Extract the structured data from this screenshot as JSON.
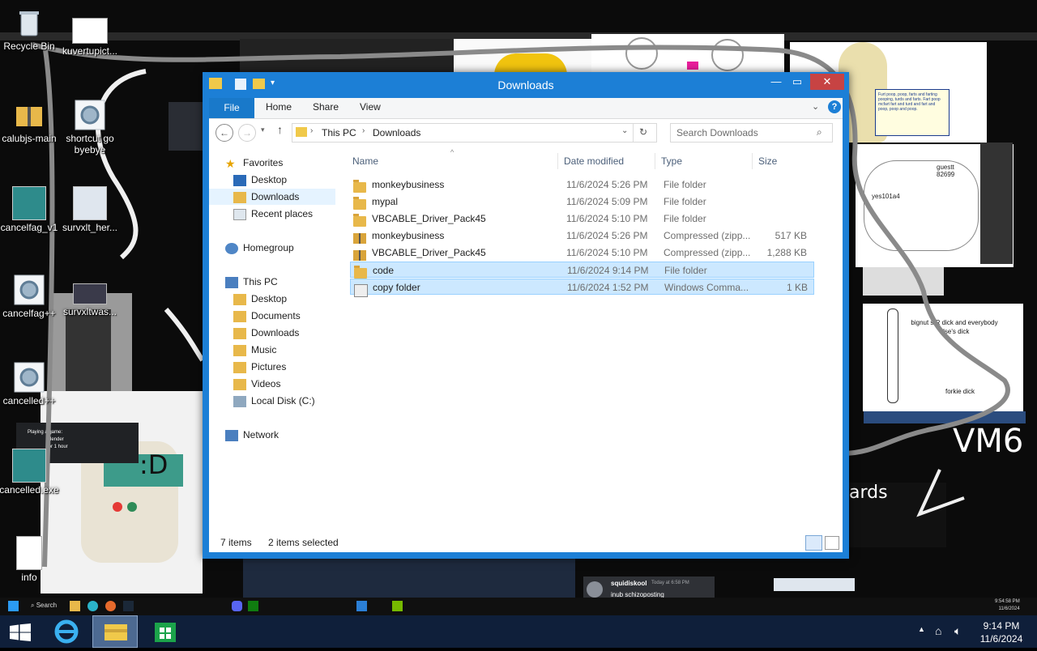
{
  "desktop": {
    "icons": [
      {
        "label": "Recycle Bin",
        "icon": "recycle-bin-icon"
      },
      {
        "label": "kuvertupict...",
        "icon": "image-icon"
      },
      {
        "label": "calubjs-main",
        "icon": "zip-folder-icon"
      },
      {
        "label": "shortcut go byebye",
        "icon": "shortcut-gear-icon"
      },
      {
        "label": "cancelfag_v1",
        "icon": "image-icon"
      },
      {
        "label": "survxlt_her...",
        "icon": "image-icon"
      },
      {
        "label": "cancelfag++",
        "icon": "shortcut-gear-icon"
      },
      {
        "label": "survxltwas...",
        "icon": "image-icon"
      },
      {
        "label": "cancelled++",
        "icon": "shortcut-gear-icon"
      },
      {
        "label": "cancelled.exe",
        "icon": "image-icon"
      },
      {
        "label": "info",
        "icon": "text-file-icon"
      }
    ],
    "overlay_texts": {
      "vm_tag": "VM6",
      "wall_note": "Furt poop, poop, farts and farting pooping, turds and farts. Fart poop mcfart fart and turd and fart and poop, poop and poop.",
      "doodle1": "bignut s/R dick and everybody else's dick",
      "doodle2": "forkie dick",
      "doodle3": "yes101a4",
      "doodle4": "guestt 82699",
      "game_label": "Playing a game:",
      "game_name": "Blender",
      "game_time": "for 1 hour",
      "face": ":D",
      "chat_user": "squidiskool",
      "chat_time": "Today at 6:58 PM",
      "chat_msg": "inub schizoposting",
      "cards": "ards",
      "vm_clock_time": "9:54:58 PM",
      "vm_clock_date": "11/6/2024",
      "vm_search": "Search"
    }
  },
  "explorer": {
    "title": "Downloads",
    "ribbon_tabs": [
      "File",
      "Home",
      "Share",
      "View"
    ],
    "breadcrumb": [
      "This PC",
      "Downloads"
    ],
    "search_placeholder": "Search Downloads",
    "nav": {
      "favorites_label": "Favorites",
      "favorites": [
        "Desktop",
        "Downloads",
        "Recent places"
      ],
      "homegroup": "Homegroup",
      "thispc_label": "This PC",
      "thispc": [
        "Desktop",
        "Documents",
        "Downloads",
        "Music",
        "Pictures",
        "Videos",
        "Local Disk (C:)"
      ],
      "network": "Network"
    },
    "columns": {
      "name": "Name",
      "date": "Date modified",
      "type": "Type",
      "size": "Size"
    },
    "files": [
      {
        "name": "monkeybusiness",
        "date": "11/6/2024 5:26 PM",
        "type": "File folder",
        "size": "",
        "icon": "folder-icon",
        "selected": false
      },
      {
        "name": "mypal",
        "date": "11/6/2024 5:09 PM",
        "type": "File folder",
        "size": "",
        "icon": "folder-icon",
        "selected": false
      },
      {
        "name": "VBCABLE_Driver_Pack45",
        "date": "11/6/2024 5:10 PM",
        "type": "File folder",
        "size": "",
        "icon": "folder-icon",
        "selected": false
      },
      {
        "name": "monkeybusiness",
        "date": "11/6/2024 5:26 PM",
        "type": "Compressed (zipp...",
        "size": "517 KB",
        "icon": "zip-icon",
        "selected": false
      },
      {
        "name": "VBCABLE_Driver_Pack45",
        "date": "11/6/2024 5:10 PM",
        "type": "Compressed (zipp...",
        "size": "1,288 KB",
        "icon": "zip-icon",
        "selected": false
      },
      {
        "name": "code",
        "date": "11/6/2024 9:14 PM",
        "type": "File folder",
        "size": "",
        "icon": "folder-icon",
        "selected": true
      },
      {
        "name": "copy folder",
        "date": "11/6/2024 1:52 PM",
        "type": "Windows Comma...",
        "size": "1 KB",
        "icon": "cmd-file-icon",
        "selected": true
      }
    ],
    "status": {
      "count": "7 items",
      "selected": "2 items selected"
    },
    "accent": "#1c7fd6",
    "selection_color": "#cce8ff"
  },
  "taskbar": {
    "clock_time": "9:14 PM",
    "clock_date": "11/6/2024",
    "pinned": [
      "internet-explorer-icon",
      "file-explorer-icon",
      "store-icon"
    ],
    "color": "#0f1f3a"
  }
}
